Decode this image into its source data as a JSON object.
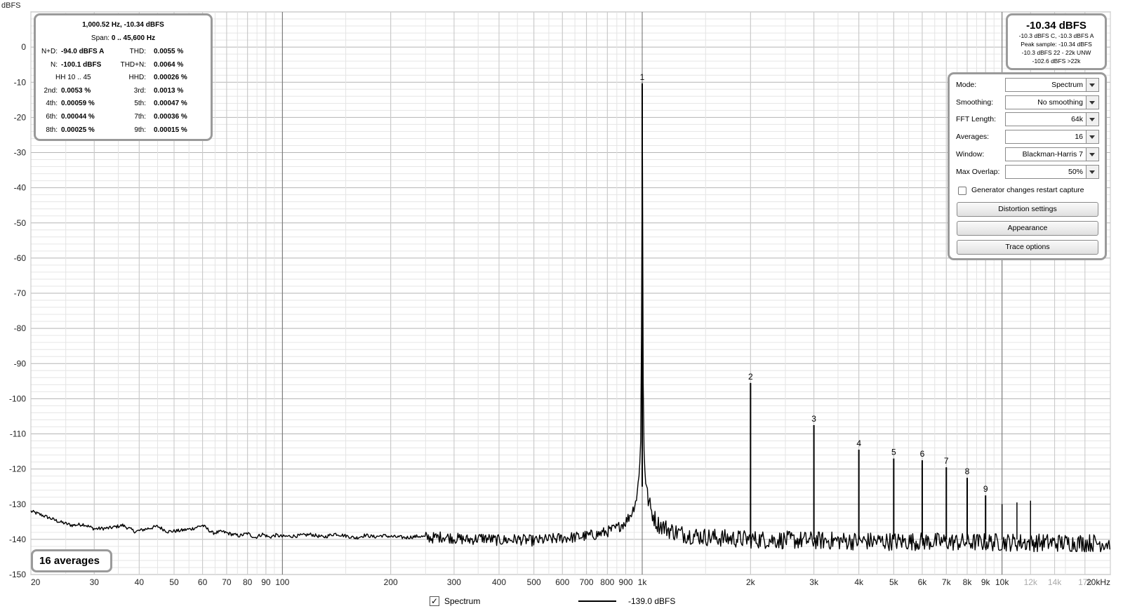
{
  "readout": {
    "cursor": "1,000.52 Hz, -10.34 dBFS",
    "span": "Span: 0 .. 45,600 Hz",
    "rows": [
      {
        "l1": "N+D:",
        "v1": "-94.0 dBFS A",
        "l2": "THD:",
        "v2": "0.0055 %"
      },
      {
        "l1": "N:",
        "v1": "-100.1 dBFS",
        "l2": "THD+N:",
        "v2": "0.0064 %"
      },
      {
        "l1": "HH 10 .. 45",
        "v1": "",
        "l2": "HHD:",
        "v2": "0.00026 %"
      },
      {
        "l1": "2nd:",
        "v1": "0.0053 %",
        "l2": "3rd:",
        "v2": "0.0013 %"
      },
      {
        "l1": "4th:",
        "v1": "0.00059 %",
        "l2": "5th:",
        "v2": "0.00047 %"
      },
      {
        "l1": "6th:",
        "v1": "0.00044 %",
        "l2": "7th:",
        "v2": "0.00036 %"
      },
      {
        "l1": "8th:",
        "v1": "0.00025 %",
        "l2": "9th:",
        "v2": "0.00015 %"
      }
    ]
  },
  "level": {
    "big": "-10.34 dBFS",
    "lines": [
      "-10.3 dBFS C, -10.3 dBFS A",
      "Peak sample: -10.34 dBFS",
      "-10.3 dBFS 22 - 22k UNW",
      "-102.6 dBFS >22k"
    ]
  },
  "settings": {
    "rows": [
      {
        "label": "Mode:",
        "value": "Spectrum"
      },
      {
        "label": "Smoothing:",
        "value": "No  smoothing"
      },
      {
        "label": "FFT Length:",
        "value": "64k"
      },
      {
        "label": "Averages:",
        "value": "16"
      },
      {
        "label": "Window:",
        "value": "Blackman-Harris 7"
      },
      {
        "label": "Max Overlap:",
        "value": "50%"
      }
    ],
    "restart_label": "Generator changes restart capture",
    "restart_checked": false,
    "buttons": [
      "Distortion settings",
      "Appearance",
      "Trace options"
    ]
  },
  "averages_badge": "16 averages",
  "legend": {
    "checked": true,
    "check_glyph": "✓",
    "name": "Spectrum",
    "value": "-139.0 dBFS",
    "line_color": "#000000"
  },
  "chart_data": {
    "type": "line",
    "ylabel": "dBFS",
    "x_scale": "log",
    "xlim": [
      20,
      20000
    ],
    "ylim": [
      -150,
      10
    ],
    "grid": true,
    "yticks": [
      0,
      -10,
      -20,
      -30,
      -40,
      -50,
      -60,
      -70,
      -80,
      -90,
      -100,
      -110,
      -120,
      -130,
      -140,
      -150
    ],
    "xticks": [
      {
        "v": 20,
        "label": "20"
      },
      {
        "v": 30,
        "label": "30"
      },
      {
        "v": 40,
        "label": "40"
      },
      {
        "v": 50,
        "label": "50"
      },
      {
        "v": 60,
        "label": "60"
      },
      {
        "v": 70,
        "label": "70"
      },
      {
        "v": 80,
        "label": "80"
      },
      {
        "v": 90,
        "label": "90"
      },
      {
        "v": 100,
        "label": "100"
      },
      {
        "v": 200,
        "label": "200"
      },
      {
        "v": 300,
        "label": "300"
      },
      {
        "v": 400,
        "label": "400"
      },
      {
        "v": 500,
        "label": "500"
      },
      {
        "v": 600,
        "label": "600"
      },
      {
        "v": 700,
        "label": "700"
      },
      {
        "v": 800,
        "label": "800"
      },
      {
        "v": 900,
        "label": "900"
      },
      {
        "v": 1000,
        "label": "1k"
      },
      {
        "v": 2000,
        "label": "2k"
      },
      {
        "v": 3000,
        "label": "3k"
      },
      {
        "v": 4000,
        "label": "4k"
      },
      {
        "v": 5000,
        "label": "5k"
      },
      {
        "v": 6000,
        "label": "6k"
      },
      {
        "v": 7000,
        "label": "7k"
      },
      {
        "v": 8000,
        "label": "8k"
      },
      {
        "v": 9000,
        "label": "9k"
      },
      {
        "v": 10000,
        "label": "10k"
      },
      {
        "v": 12000,
        "label": "12k",
        "dim": true
      },
      {
        "v": 14000,
        "label": "14k",
        "dim": true
      },
      {
        "v": 17000,
        "label": "17k",
        "dim": true
      },
      {
        "v": 20000,
        "label": "20kHz"
      }
    ],
    "harmonics": [
      {
        "n": "1",
        "f": 1000,
        "db": -10.3
      },
      {
        "n": "2",
        "f": 2000,
        "db": -95.5
      },
      {
        "n": "3",
        "f": 3000,
        "db": -107.5
      },
      {
        "n": "4",
        "f": 4000,
        "db": -114.5
      },
      {
        "n": "5",
        "f": 5000,
        "db": -117.0
      },
      {
        "n": "6",
        "f": 6000,
        "db": -117.5
      },
      {
        "n": "7",
        "f": 7000,
        "db": -119.5
      },
      {
        "n": "8",
        "f": 8000,
        "db": -122.5
      },
      {
        "n": "9",
        "f": 9000,
        "db": -127.5
      }
    ],
    "extra_spurs": [
      {
        "f": 10000,
        "db": -130.0
      },
      {
        "f": 11000,
        "db": -129.5
      },
      {
        "f": 12000,
        "db": -129.0
      }
    ],
    "series": [
      {
        "color": "#000000",
        "points": [
          [
            20,
            -132
          ],
          [
            22,
            -133.5
          ],
          [
            24,
            -135
          ],
          [
            26,
            -136
          ],
          [
            28,
            -135.7
          ],
          [
            30,
            -137
          ],
          [
            33,
            -136.8
          ],
          [
            36,
            -136
          ],
          [
            39,
            -137.8
          ],
          [
            42,
            -137
          ],
          [
            45,
            -136.3
          ],
          [
            48,
            -137.8
          ],
          [
            52,
            -137.5
          ],
          [
            56,
            -137
          ],
          [
            60,
            -136
          ],
          [
            64,
            -138.2
          ],
          [
            68,
            -137.8
          ],
          [
            72,
            -138.5
          ],
          [
            76,
            -139
          ],
          [
            80,
            -138.3
          ],
          [
            84,
            -139.5
          ],
          [
            88,
            -138.5
          ],
          [
            92,
            -139.4
          ],
          [
            96,
            -138.8
          ],
          [
            100,
            -139.2
          ],
          [
            110,
            -139
          ],
          [
            120,
            -138.6
          ],
          [
            130,
            -139.4
          ],
          [
            140,
            -138.4
          ],
          [
            150,
            -139
          ],
          [
            160,
            -139.6
          ],
          [
            170,
            -138.8
          ],
          [
            180,
            -139.3
          ],
          [
            190,
            -138.9
          ],
          [
            200,
            -139.2
          ],
          [
            220,
            -139.5
          ],
          [
            240,
            -139.1
          ],
          [
            260,
            -139.6
          ],
          [
            280,
            -139.2
          ],
          [
            300,
            -139.7
          ],
          [
            330,
            -140.1
          ],
          [
            360,
            -139.6
          ],
          [
            400,
            -140.3
          ],
          [
            450,
            -140
          ],
          [
            500,
            -140.4
          ],
          [
            550,
            -140
          ],
          [
            600,
            -139.6
          ],
          [
            650,
            -139.4
          ],
          [
            700,
            -139
          ],
          [
            750,
            -138.6
          ],
          [
            800,
            -137.8
          ],
          [
            850,
            -136.8
          ],
          [
            900,
            -135
          ],
          [
            940,
            -132
          ],
          [
            965,
            -128
          ],
          [
            980,
            -122
          ],
          [
            990,
            -112
          ],
          [
            995,
            -90
          ],
          [
            998,
            -40
          ],
          [
            1000,
            -10.3
          ],
          [
            1002,
            -40
          ],
          [
            1005,
            -90
          ],
          [
            1010,
            -112
          ],
          [
            1020,
            -122
          ],
          [
            1035,
            -128
          ],
          [
            1060,
            -132
          ],
          [
            1100,
            -135.5
          ],
          [
            1200,
            -137.5
          ],
          [
            1300,
            -138.5
          ],
          [
            1500,
            -139.3
          ],
          [
            1700,
            -139.7
          ],
          [
            2000,
            -140
          ],
          [
            2500,
            -140.2
          ],
          [
            3000,
            -140.3
          ],
          [
            4000,
            -140.5
          ],
          [
            5000,
            -140.6
          ],
          [
            6000,
            -140.6
          ],
          [
            7000,
            -140.7
          ],
          [
            8000,
            -140.8
          ],
          [
            10000,
            -140.8
          ],
          [
            12000,
            -140.9
          ],
          [
            15000,
            -141
          ],
          [
            20000,
            -141
          ]
        ]
      }
    ]
  }
}
